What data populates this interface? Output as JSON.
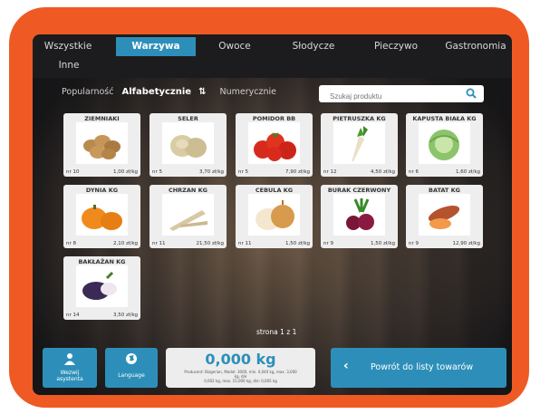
{
  "tabs": [
    {
      "label": "Wszystkie",
      "active": false
    },
    {
      "label": "Warzywa",
      "active": true
    },
    {
      "label": "Owoce",
      "active": false
    },
    {
      "label": "Słodycze",
      "active": false
    },
    {
      "label": "Pieczywo",
      "active": false
    },
    {
      "label": "Gastronomia",
      "active": false
    },
    {
      "label": "Inne",
      "active": false
    }
  ],
  "sort": {
    "popularity": "Popularność",
    "alphabetical": "Alfabetycznie",
    "numeric": "Numerycznie"
  },
  "search": {
    "placeholder": "Szukaj produktu",
    "icon": "search-icon"
  },
  "products": [
    {
      "name": "ZIEMNIAKI",
      "nr": "nr 10",
      "price": "1,00 zł/kg",
      "image": "potatoes"
    },
    {
      "name": "SELER",
      "nr": "nr 5",
      "price": "3,70 zł/kg",
      "image": "celeriac"
    },
    {
      "name": "POMIDOR BB",
      "nr": "nr 5",
      "price": "7,90 zł/kg",
      "image": "tomatoes"
    },
    {
      "name": "PIETRUSZKA KG",
      "nr": "nr 12",
      "price": "4,50 zł/kg",
      "image": "parsley-root"
    },
    {
      "name": "KAPUSTA BIAŁA KG",
      "nr": "nr 6",
      "price": "1,60 zł/kg",
      "image": "cabbage"
    },
    {
      "name": "DYNIA KG",
      "nr": "nr 8",
      "price": "2,10 zł/kg",
      "image": "pumpkin"
    },
    {
      "name": "CHRZAN KG",
      "nr": "nr 11",
      "price": "21,50 zł/kg",
      "image": "horseradish"
    },
    {
      "name": "CEBULA KG",
      "nr": "nr 11",
      "price": "1,50 zł/kg",
      "image": "onion"
    },
    {
      "name": "BURAK CZERWONY",
      "nr": "nr 9",
      "price": "1,50 zł/kg",
      "image": "beetroot"
    },
    {
      "name": "BATAT KG",
      "nr": "nr 9",
      "price": "12,90 zł/kg",
      "image": "sweet-potato"
    },
    {
      "name": "BAKŁAŻAN KG",
      "nr": "nr 14",
      "price": "3,50 zł/kg",
      "image": "eggplant"
    }
  ],
  "pager": "strona 1 z 1",
  "bottom": {
    "assistant_label": "Wezwij asystenta",
    "language_label": "Language",
    "weight_value": "0,000 kg",
    "weight_note_1": "Producent: Bizgerian, Model: 3000, min. 0,040 kg, max. 3,000 kg, d/e",
    "weight_note_2": "0,002 kg, max. 15,000 kg, d/e: 0,005 kg",
    "back_label": "Powrót do listy towarów"
  },
  "colors": {
    "accent": "#2d8fb9",
    "frame": "#ef5a24",
    "topbar": "#1c1c1e"
  }
}
